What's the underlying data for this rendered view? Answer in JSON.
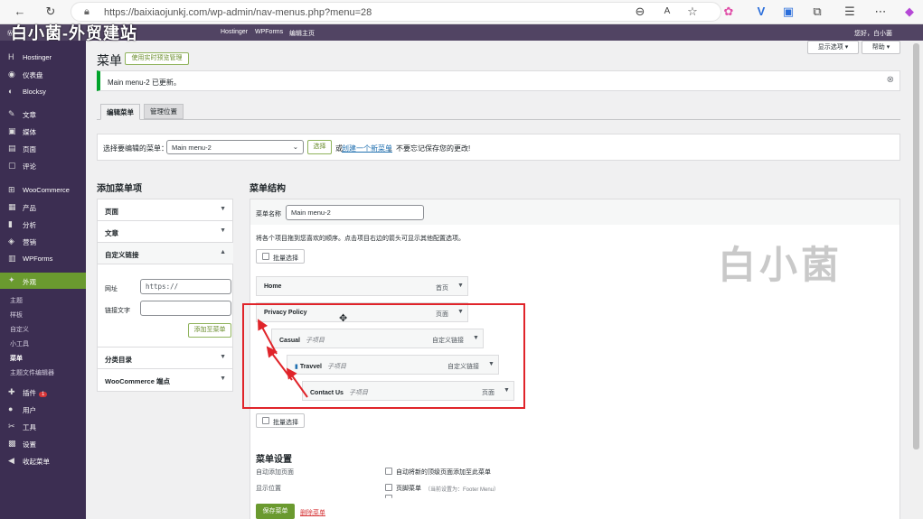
{
  "browser": {
    "url": "https://baixiaojunkj.com/wp-admin/nav-menus.php?menu=28"
  },
  "watermark_top": "白小菌-外贸建站",
  "adminbar": {
    "items": [
      "Hostinger",
      "WPForms",
      "编辑主页"
    ],
    "greeting": "您好，白小菌"
  },
  "sidebar": {
    "items": [
      {
        "label": "Hostinger",
        "icon": "H"
      },
      {
        "label": "仪表盘",
        "icon": "◉"
      },
      {
        "label": "Blocksy",
        "icon": "◐"
      },
      {
        "label": "文章",
        "icon": "✎"
      },
      {
        "label": "媒体",
        "icon": "▣"
      },
      {
        "label": "页面",
        "icon": "▤"
      },
      {
        "label": "评论",
        "icon": "▢"
      },
      {
        "label": "WooCommerce",
        "icon": "⊞"
      },
      {
        "label": "产品",
        "icon": "▦"
      },
      {
        "label": "分析",
        "icon": "▮"
      },
      {
        "label": "营销",
        "icon": "◈"
      },
      {
        "label": "WPForms",
        "icon": "▥"
      },
      {
        "label": "外观",
        "icon": "✦"
      }
    ],
    "appearance_sub": [
      "主题",
      "样板",
      "自定义",
      "小工具",
      "菜单",
      "主题文件编辑器"
    ],
    "lower_items": [
      {
        "label": "插件",
        "icon": "✚",
        "badge": "1"
      },
      {
        "label": "用户",
        "icon": "●"
      },
      {
        "label": "工具",
        "icon": "✂"
      },
      {
        "label": "设置",
        "icon": "▩"
      },
      {
        "label": "收起菜单",
        "icon": "◀"
      }
    ]
  },
  "header": {
    "title": "菜单",
    "live_preview_button": "使用实时预览管理",
    "screen_options": "显示选项 ▾",
    "help": "帮助 ▾"
  },
  "notice": {
    "text": "Main menu-2 已更新。"
  },
  "tabs": [
    "编辑菜单",
    "管理位置"
  ],
  "select_menu": {
    "label": "选择要编辑的菜单：",
    "value": "Main menu-2",
    "select_button": "选择",
    "or_text": "或",
    "create_link": "创建一个新菜单",
    "save_reminder": "。不要忘记保存您的更改!"
  },
  "add_items": {
    "heading": "添加菜单项",
    "sections": [
      "页面",
      "文章",
      "自定义链接",
      "分类目录",
      "WooCommerce 端点"
    ],
    "url_label": "网址",
    "url_placeholder": "https://",
    "link_text_label": "链接文字",
    "add_button": "添加至菜单"
  },
  "menu_structure": {
    "heading": "菜单结构",
    "name_label": "菜单名称",
    "name_value": "Main menu-2",
    "instructions": "将各个项目拖到您喜欢的顺序。点击项目右边的箭头可显示其他配置选项。",
    "bulk_select": "批量选择",
    "items": [
      {
        "name": "Home",
        "sub": "",
        "type": "首页"
      },
      {
        "name": "Privacy Policy",
        "sub": "",
        "type": "页面"
      },
      {
        "name": "Casual",
        "sub": "子项目",
        "type": "自定义链接"
      },
      {
        "name": "Travvel",
        "sub": "子项目",
        "type": "自定义链接"
      },
      {
        "name": "Contact Us",
        "sub": "子项目",
        "type": "页面"
      }
    ]
  },
  "menu_settings": {
    "heading": "菜单设置",
    "auto_add_label": "自动添加页面",
    "auto_add_option": "自动将新的顶级页面添加至此菜单",
    "display_location_label": "显示位置",
    "location_option": "页脚菜单",
    "location_note": "（当前设置为：Footer Menu）",
    "save_button": "保存菜单",
    "delete_link": "删除菜单"
  },
  "watermark_big": "白小菌",
  "colors": {
    "sidebar": "#3c2e52",
    "adminbar": "#514463",
    "accent_green": "#6a9a2f",
    "highlight_red": "#e0242a"
  }
}
